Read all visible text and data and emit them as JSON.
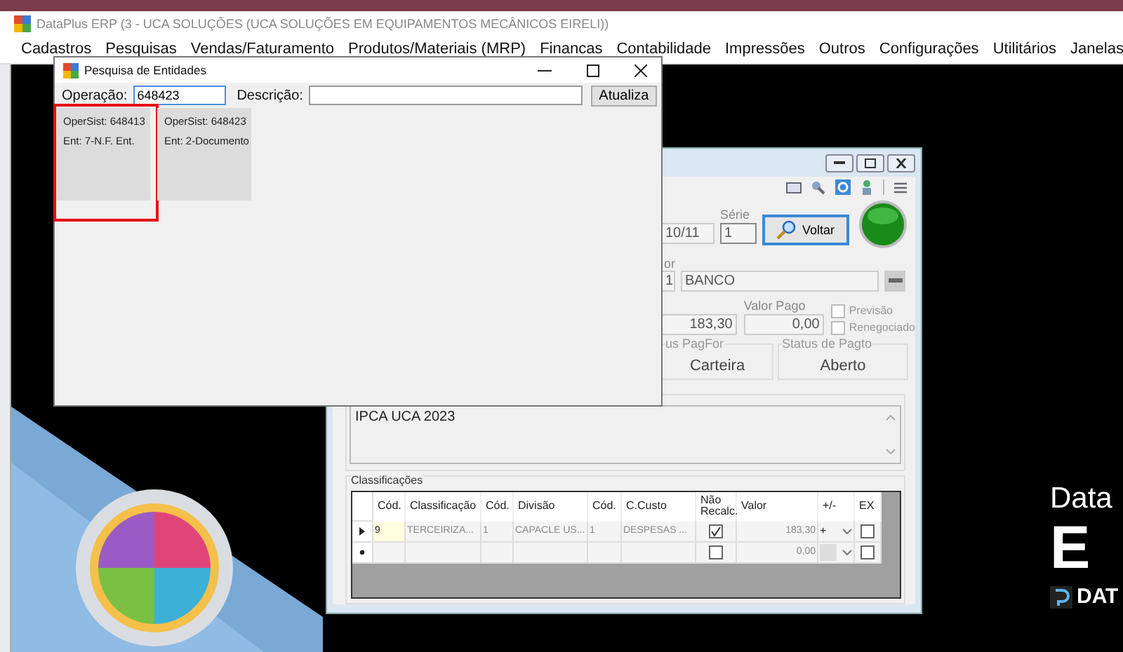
{
  "app": {
    "title": "DataPlus ERP (3 - UCA SOLUÇÕES  (UCA SOLUÇÕES EM EQUIPAMENTOS MECÂNICOS EIRELI))"
  },
  "menu": [
    "Cadastros",
    "Pesquisas",
    "Vendas/Faturamento",
    "Produtos/Materiais (MRP)",
    "Financas",
    "Contabilidade",
    "Impressões",
    "Outros",
    "Configurações",
    "Utilitários",
    "Janelas"
  ],
  "dialog": {
    "title": "Pesquisa de Entidades",
    "operation_label": "Operação:",
    "operation_value": "648423",
    "description_label": "Descrição:",
    "refresh_button": "Atualiza",
    "cards": [
      {
        "lines": [
          "OperSist: 648413",
          "Ent: 7-N.F. Ent."
        ],
        "highlighted": true
      },
      {
        "lines": [
          "OperSist: 648423",
          "Ent: 2-Documento"
        ],
        "highlighted": false
      }
    ]
  },
  "record_window": {
    "date_value": "10/11",
    "series_label": "Série",
    "series_value": "1",
    "back_button": "Voltar",
    "supplier_label": "or",
    "supplier_code": "1",
    "supplier_name": "BANCO",
    "value": "183,30",
    "paid_label": "Valor Pago",
    "paid_value": "0,00",
    "options": [
      {
        "label": "Previsão",
        "checked": false
      },
      {
        "label": "Renegociado",
        "checked": false
      }
    ],
    "status_boxes": [
      {
        "label": "us PagFor",
        "value": "Carteira"
      },
      {
        "label": "Status de Pagto",
        "value": "Aberto"
      }
    ],
    "memo": "IPCA UCA 2023",
    "grid_title": "Classificações",
    "columns": [
      "Cód.",
      "Classificação",
      "Cód.",
      "Divisão",
      "Cód.",
      "C.Custo",
      "Não Recalc.",
      "Valor",
      "+/-",
      "EX"
    ],
    "rows": [
      {
        "kind": "current",
        "cells": [
          "9",
          "TERCEIRIZA...",
          "1",
          "CAPACLE US...",
          "1",
          "DESPESAS ..."
        ],
        "no_recalc": true,
        "value": "183,30",
        "sign": "+",
        "ex": false
      },
      {
        "kind": "new",
        "cells": [
          "",
          "",
          "",
          "",
          "",
          ""
        ],
        "no_recalc": false,
        "value": "0,00",
        "sign": "",
        "ex": false
      }
    ]
  },
  "brand": {
    "line1": "Data",
    "line2": "E",
    "line3": "DAT"
  }
}
